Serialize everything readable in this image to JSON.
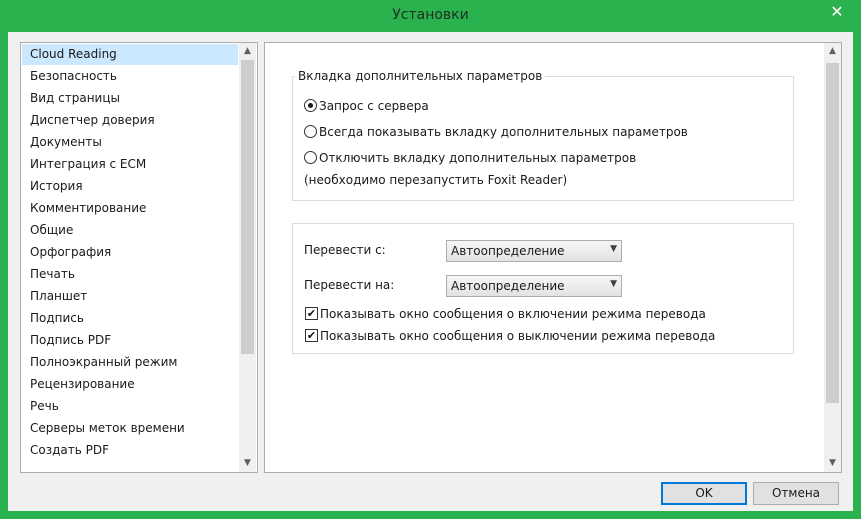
{
  "window": {
    "title": "Установки",
    "close_glyph": "✕"
  },
  "sidebar": {
    "items": [
      {
        "label": "Cloud Reading",
        "selected": true
      },
      {
        "label": "Безопасность"
      },
      {
        "label": "Вид страницы"
      },
      {
        "label": "Диспетчер доверия"
      },
      {
        "label": "Документы"
      },
      {
        "label": "Интеграция с ECM"
      },
      {
        "label": "История"
      },
      {
        "label": "Комментирование"
      },
      {
        "label": "Общие"
      },
      {
        "label": "Орфография"
      },
      {
        "label": "Печать"
      },
      {
        "label": "Планшет"
      },
      {
        "label": "Подпись"
      },
      {
        "label": "Подпись PDF"
      },
      {
        "label": "Полноэкранный режим"
      },
      {
        "label": "Рецензирование"
      },
      {
        "label": "Речь"
      },
      {
        "label": "Серверы меток времени"
      },
      {
        "label": "Создать PDF"
      }
    ]
  },
  "panel": {
    "extra_tab_group": {
      "title": "Вкладка дополнительных параметров",
      "options": [
        {
          "label": "Запрос с сервера",
          "checked": true
        },
        {
          "label": "Всегда показывать вкладку дополнительных параметров",
          "checked": false
        },
        {
          "label": "Отключить вкладку дополнительных параметров",
          "checked": false
        }
      ],
      "note": "(необходимо перезапустить Foxit Reader)"
    },
    "translate_group": {
      "from_label": "Перевести с:",
      "from_value": "Автоопределение",
      "to_label": "Перевести на:",
      "to_value": "Автоопределение",
      "checkboxes": [
        {
          "label": "Показывать окно сообщения о включении режима перевода",
          "checked": true
        },
        {
          "label": "Показывать окно сообщения о выключении режима перевода",
          "checked": true
        }
      ]
    }
  },
  "buttons": {
    "ok": "OK",
    "cancel": "Отмена"
  },
  "icons": {
    "close": "close-icon",
    "scroll_up": "chevron-up-icon",
    "scroll_down": "chevron-down-icon",
    "dropdown": "chevron-down-icon",
    "check": "checkmark-icon"
  },
  "colors": {
    "title_bar": "#2ab24f",
    "selected_item": "#cce8ff",
    "default_button_border": "#0078d7"
  }
}
